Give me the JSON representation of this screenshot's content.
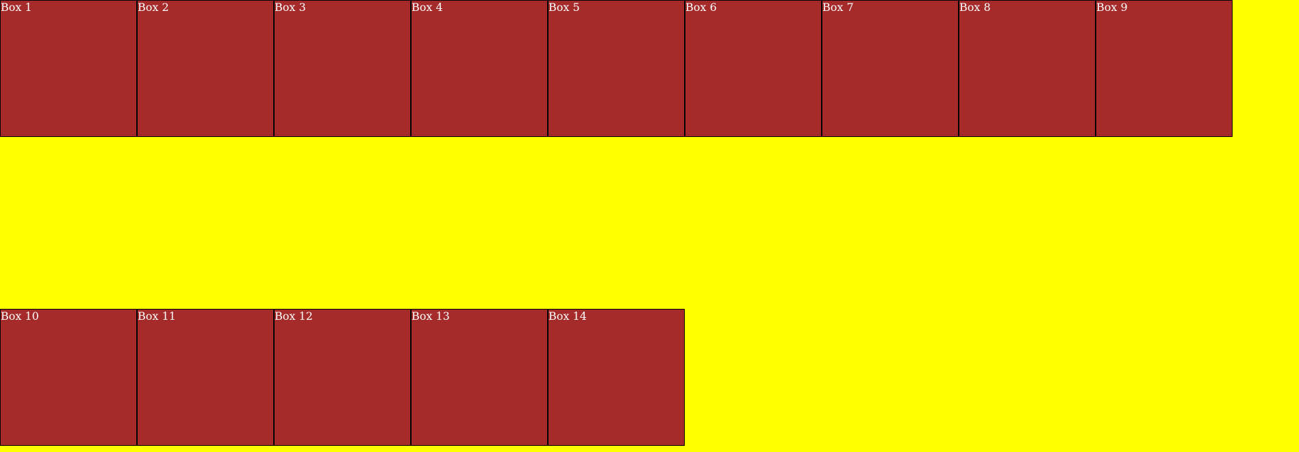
{
  "colors": {
    "background": "#ffff00",
    "box_fill": "#a52a2a",
    "box_border": "#000000",
    "box_text": "#ffffff"
  },
  "row1": [
    "Box 1",
    "Box 2",
    "Box 3",
    "Box 4",
    "Box 5",
    "Box 6",
    "Box 7",
    "Box 8",
    "Box 9"
  ],
  "row2": [
    "Box 10",
    "Box 11",
    "Box 12",
    "Box 13",
    "Box 14"
  ]
}
